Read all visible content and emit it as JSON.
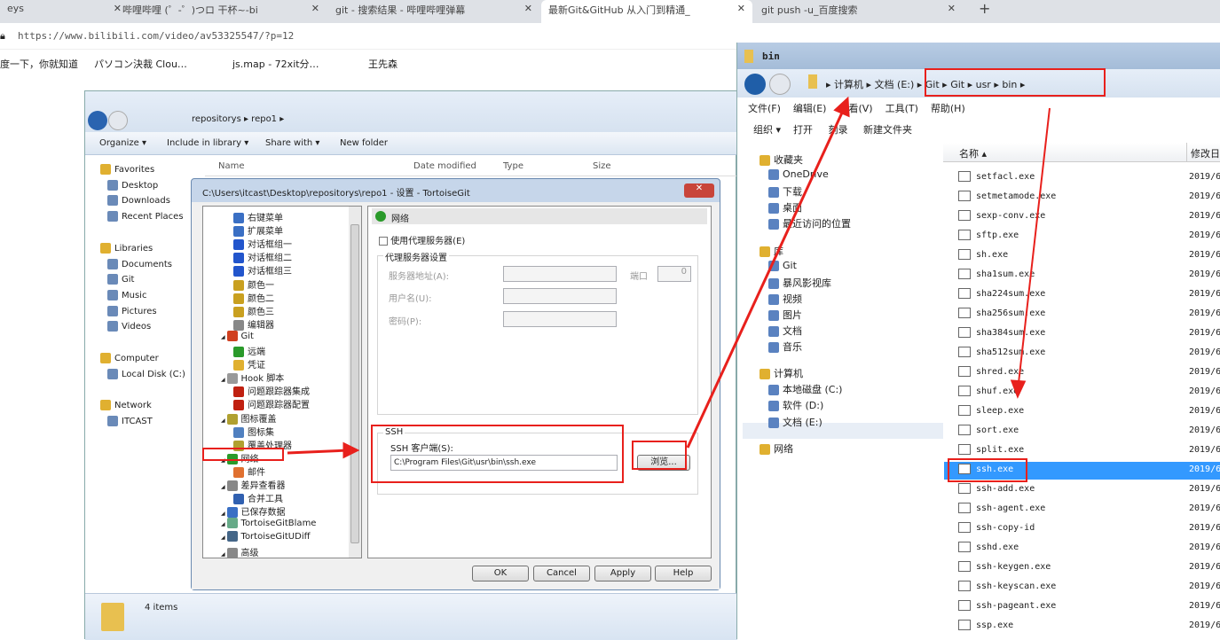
{
  "browser": {
    "tabs": [
      {
        "label": "eys"
      },
      {
        "label": "哔哩哔哩 (゜-゜)つロ 干杯~-bi"
      },
      {
        "label": "git - 搜索结果 - 哔哩哔哩弹幕"
      },
      {
        "label": "最新Git&GitHub 从入门到精通_"
      },
      {
        "label": "git push -u_百度搜索"
      }
    ],
    "url": "https://www.bilibili.com/video/av53325547/?p=12",
    "bookmarks": [
      "度一下，你就知道",
      "パソコン決裁 Clou…",
      "js.map - 72xit分…",
      "王先森"
    ]
  },
  "explorer_left": {
    "breadcrumb": [
      "repositorys",
      "repo1"
    ],
    "toolbar": [
      "Organize ▾",
      "Include in library ▾",
      "Share with ▾",
      "New folder"
    ],
    "columns": [
      "Name",
      "Date modified",
      "Type",
      "Size"
    ],
    "nav": [
      {
        "label": "Favorites",
        "h": 1
      },
      {
        "label": "Desktop"
      },
      {
        "label": "Downloads"
      },
      {
        "label": "Recent Places"
      },
      {
        "label": "Libraries",
        "h": 1
      },
      {
        "label": "Documents"
      },
      {
        "label": "Git"
      },
      {
        "label": "Music"
      },
      {
        "label": "Pictures"
      },
      {
        "label": "Videos"
      },
      {
        "label": "Computer",
        "h": 1
      },
      {
        "label": "Local Disk (C:)"
      },
      {
        "label": "Network",
        "h": 1
      },
      {
        "label": "ITCAST"
      }
    ],
    "status": "4 items"
  },
  "dialog": {
    "title": "C:\\Users\\itcast\\Desktop\\repositorys\\repo1 - 设置 - TortoiseGit",
    "tree": [
      {
        "label": "右键菜单",
        "l": 2,
        "c": "#3a6fc4"
      },
      {
        "label": "扩展菜单",
        "l": 2,
        "c": "#3a6fc4"
      },
      {
        "label": "对话框组一",
        "l": 2,
        "c": "#2255cc"
      },
      {
        "label": "对话框组二",
        "l": 2,
        "c": "#2255cc"
      },
      {
        "label": "对话框组三",
        "l": 2,
        "c": "#2255cc"
      },
      {
        "label": "颜色一",
        "l": 2,
        "c": "#c9a020"
      },
      {
        "label": "颜色二",
        "l": 2,
        "c": "#c9a020"
      },
      {
        "label": "颜色三",
        "l": 2,
        "c": "#c9a020"
      },
      {
        "label": "编辑器",
        "l": 2,
        "c": "#888"
      },
      {
        "label": "Git",
        "l": 1,
        "c": "#d04020"
      },
      {
        "label": "远端",
        "l": 2,
        "c": "#2a9a2a"
      },
      {
        "label": "凭证",
        "l": 2,
        "c": "#e0b030"
      },
      {
        "label": "Hook 脚本",
        "l": 1,
        "c": "#999"
      },
      {
        "label": "问题跟踪器集成",
        "l": 2,
        "c": "#c02010"
      },
      {
        "label": "问题跟踪器配置",
        "l": 2,
        "c": "#c02010"
      },
      {
        "label": "图标覆盖",
        "l": 1,
        "c": "#b0a030"
      },
      {
        "label": "图标集",
        "l": 2,
        "c": "#5080c0"
      },
      {
        "label": "覆盖处理器",
        "l": 2,
        "c": "#b0a030"
      },
      {
        "label": "网络",
        "l": 1,
        "c": "#2a9a2a"
      },
      {
        "label": "邮件",
        "l": 2,
        "c": "#e07030"
      },
      {
        "label": "差异查看器",
        "l": 1,
        "c": "#888"
      },
      {
        "label": "合并工具",
        "l": 2,
        "c": "#3060b0"
      },
      {
        "label": "已保存数据",
        "l": 1,
        "c": "#3a6fc4"
      },
      {
        "label": "TortoiseGitBlame",
        "l": 1,
        "c": "#6a8"
      },
      {
        "label": "TortoiseGitUDiff",
        "l": 1,
        "c": "#468"
      },
      {
        "label": "高级",
        "l": 1,
        "c": "#888"
      }
    ],
    "panel_title": "网络",
    "use_proxy": "使用代理服务器(E)",
    "proxy_group": "代理服务器设置",
    "server_label": "服务器地址(A):",
    "port_label": "端口",
    "port_value": "0",
    "user_label": "用户名(U):",
    "pass_label": "密码(P):",
    "ssh_group": "SSH",
    "ssh_client_label": "SSH 客户端(S):",
    "ssh_client_value": "C:\\Program Files\\Git\\usr\\bin\\ssh.exe",
    "browse": "浏览...",
    "ok": "OK",
    "cancel": "Cancel",
    "apply": "Apply",
    "help": "Help"
  },
  "explorer_right": {
    "title": "bin",
    "breadcrumb": "▸ 计算机 ▸ 文档 (E:) ▸ Git ▸ Git ▸ usr ▸ bin ▸",
    "menu": [
      "文件(F)",
      "编辑(E)",
      "查看(V)",
      "工具(T)",
      "帮助(H)"
    ],
    "toolbar": [
      "组织 ▾",
      "打开",
      "刻录",
      "新建文件夹"
    ],
    "columns": [
      "名称",
      "修改日"
    ],
    "nav": [
      {
        "label": "收藏夹",
        "l": 0
      },
      {
        "label": "OneDrive",
        "l": 1
      },
      {
        "label": "下载",
        "l": 1
      },
      {
        "label": "桌面",
        "l": 1
      },
      {
        "label": "最近访问的位置",
        "l": 1
      },
      {
        "label": "",
        "l": -1
      },
      {
        "label": "库",
        "l": 0
      },
      {
        "label": "Git",
        "l": 1
      },
      {
        "label": "暴风影视库",
        "l": 1
      },
      {
        "label": "视频",
        "l": 1
      },
      {
        "label": "图片",
        "l": 1
      },
      {
        "label": "文档",
        "l": 1
      },
      {
        "label": "音乐",
        "l": 1
      },
      {
        "label": "",
        "l": -1
      },
      {
        "label": "计算机",
        "l": 0
      },
      {
        "label": "本地磁盘 (C:)",
        "l": 1
      },
      {
        "label": "软件 (D:)",
        "l": 1
      },
      {
        "label": "文档 (E:)",
        "l": 1
      },
      {
        "label": "",
        "l": -1
      },
      {
        "label": "网络",
        "l": 0
      }
    ],
    "files": [
      "setfacl.exe",
      "setmetamode.exe",
      "sexp-conv.exe",
      "sftp.exe",
      "sh.exe",
      "sha1sum.exe",
      "sha224sum.exe",
      "sha256sum.exe",
      "sha384sum.exe",
      "sha512sum.exe",
      "shred.exe",
      "shuf.exe",
      "sleep.exe",
      "sort.exe",
      "split.exe",
      "ssh.exe",
      "ssh-add.exe",
      "ssh-agent.exe",
      "ssh-copy-id",
      "sshd.exe",
      "ssh-keygen.exe",
      "ssh-keyscan.exe",
      "ssh-pageant.exe",
      "ssp.exe"
    ],
    "date": "2019/6",
    "selected": "ssh.exe"
  },
  "colors": {
    "highlight": "#e8201c",
    "selection": "#3399ff"
  }
}
